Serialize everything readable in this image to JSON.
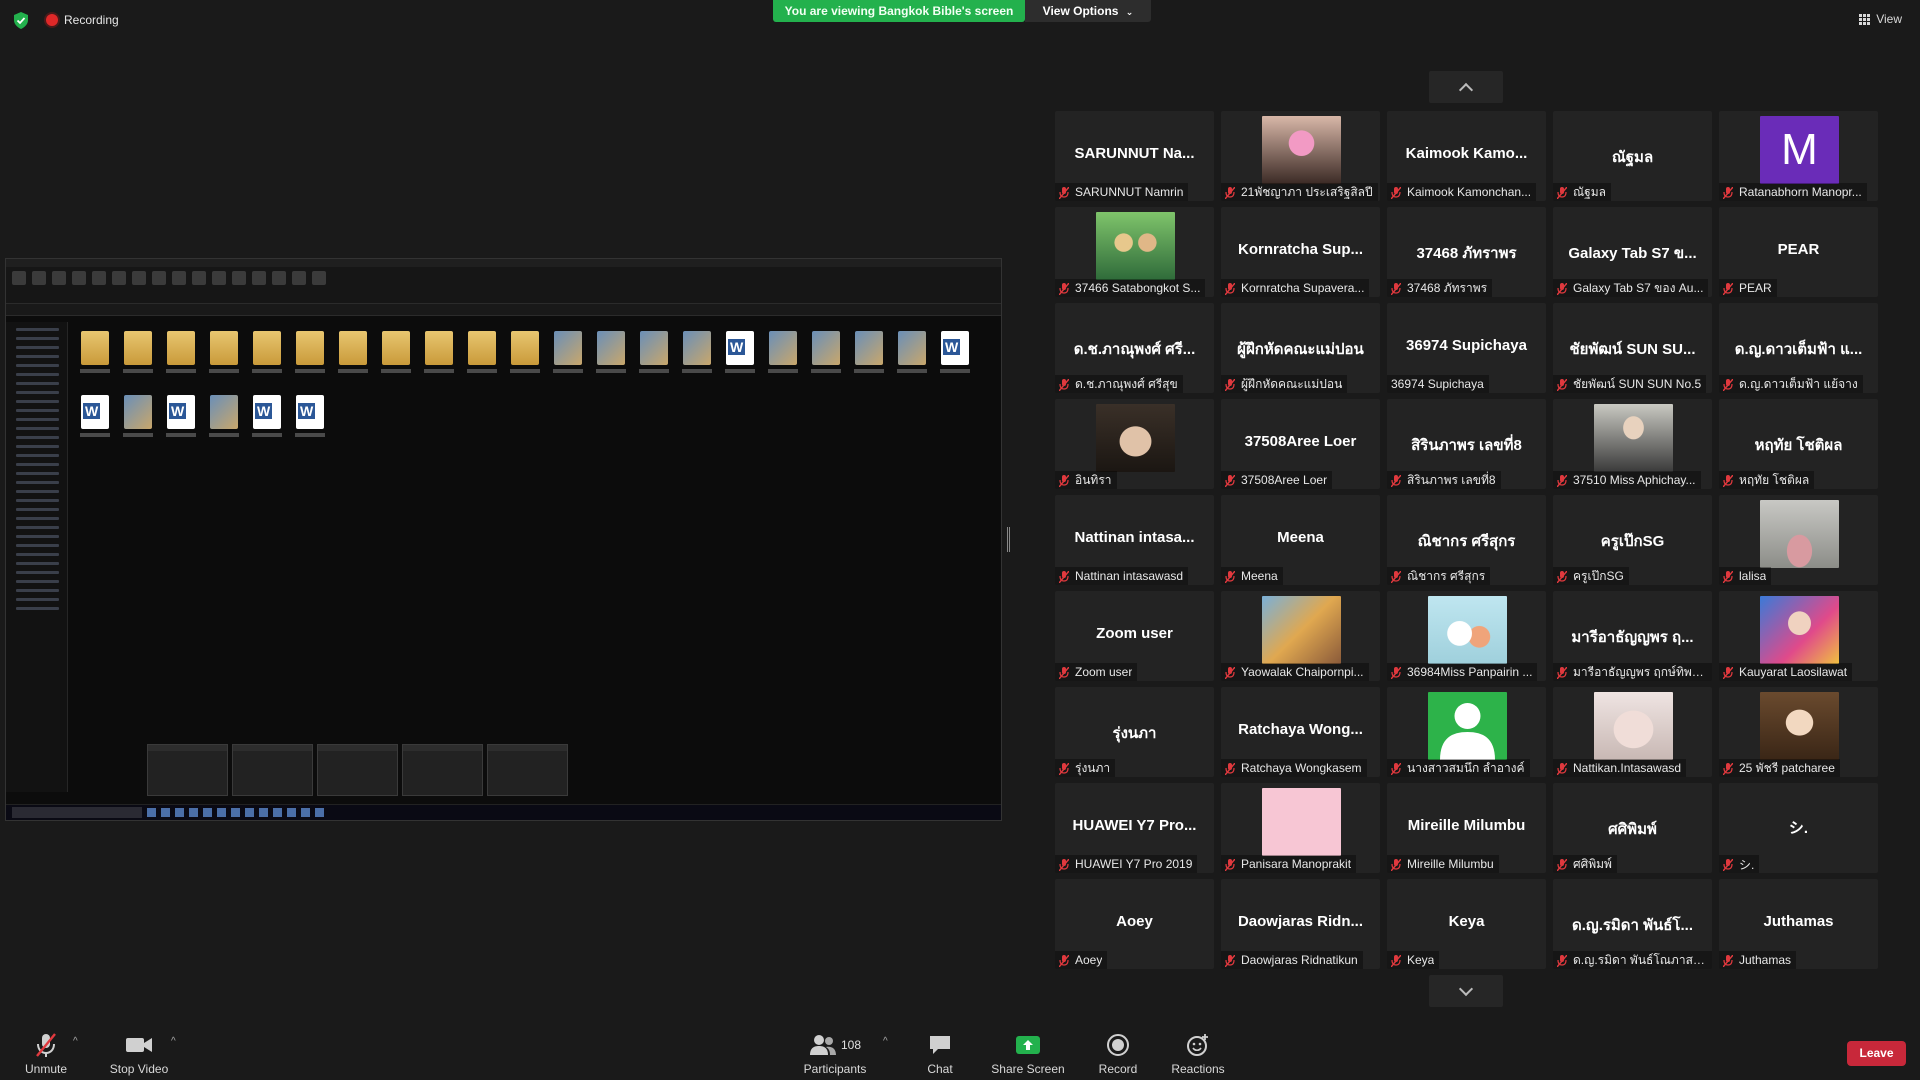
{
  "top": {
    "recording_label": "Recording",
    "viewing_banner": "You are viewing Bangkok Bible's screen",
    "view_options": "View Options",
    "view_label": "View"
  },
  "participants": [
    {
      "display": "SARUNNUT Na...",
      "label": "SARUNNUT Namrin",
      "pic": ""
    },
    {
      "display": "",
      "label": "21พัชญาภา ประเสริฐสิลปี",
      "pic": "photo-pink-glasses"
    },
    {
      "display": "Kaimook Kamo...",
      "label": "Kaimook Kamonchan...",
      "pic": ""
    },
    {
      "display": "ณัฐมล",
      "label": "ณัฐมล",
      "pic": ""
    },
    {
      "display": "",
      "label": "Ratanabhorn Manopr...",
      "pic": "avatar-m",
      "avatar_letter": "M"
    },
    {
      "display": "",
      "label": "37466 Satabongkot S...",
      "pic": "photo-garden"
    },
    {
      "display": "Kornratcha Sup...",
      "label": "Kornratcha Supavera...",
      "pic": ""
    },
    {
      "display": "37468 ภัทราพร",
      "label": "37468 ภัทราพร",
      "pic": ""
    },
    {
      "display": "Galaxy Tab S7 ข...",
      "label": "Galaxy Tab S7 ของ Au...",
      "pic": ""
    },
    {
      "display": "PEAR",
      "label": "PEAR",
      "pic": ""
    },
    {
      "display": "ด.ช.ภาณุพงศ์ ศรี...",
      "label": "ด.ช.ภาณุพงศ์ ศรีสุข",
      "pic": ""
    },
    {
      "display": "ผู้ฝึกหัดคณะแม่ปอน",
      "label": "ผู้ฝึกหัดคณะแม่ปอน",
      "pic": ""
    },
    {
      "display": "36974 Supichaya",
      "label": "36974 Supichaya",
      "pic": "",
      "muted": false
    },
    {
      "display": "ชัยพัฒน์ SUN SU...",
      "label": "ชัยพัฒน์ SUN SUN No.5",
      "pic": ""
    },
    {
      "display": "ด.ญ.ดาวเต็มฟ้า แ...",
      "label": "ด.ญ.ดาวเต็มฟ้า แย้จาง",
      "pic": ""
    },
    {
      "display": "",
      "label": "อินทิรา",
      "pic": "photo-anime-boy"
    },
    {
      "display": "37508Aree Loer",
      "label": "37508Aree Loer",
      "pic": ""
    },
    {
      "display": "สิรินภาพร เลขที่8",
      "label": "สิรินภาพร เลขที่8",
      "pic": ""
    },
    {
      "display": "",
      "label": "37510 Miss Aphichay...",
      "pic": "photo-man-suit"
    },
    {
      "display": "หฤทัย โชติผล",
      "label": "หฤทัย โชติผล",
      "pic": ""
    },
    {
      "display": "Nattinan intasa...",
      "label": "Nattinan intasawasd",
      "pic": ""
    },
    {
      "display": "Meena",
      "label": "Meena",
      "pic": ""
    },
    {
      "display": "ณิชากร ศรีสุกร",
      "label": "ณิชากร ศรีสุกร",
      "pic": ""
    },
    {
      "display": "ครูเป๊กSG",
      "label": "ครูเป๊กSG",
      "pic": ""
    },
    {
      "display": "",
      "label": "lalisa",
      "pic": "photo-lalisa"
    },
    {
      "display": "Zoom user",
      "label": "Zoom user",
      "pic": ""
    },
    {
      "display": "",
      "label": "Yaowalak Chaipornpi...",
      "pic": "photo-cartoon-crowd"
    },
    {
      "display": "",
      "label": "36984Miss Panpairin ...",
      "pic": "photo-cartoon-friends"
    },
    {
      "display": "มารีอาธัญญพร ฤ...",
      "label": "มารีอาธัญญพร ฤกษ์ทิพย์...",
      "pic": ""
    },
    {
      "display": "",
      "label": "Kauyarat Laosilawat",
      "pic": "photo-colorful-boy"
    },
    {
      "display": "รุ่งนภา",
      "label": "รุ่งนภา",
      "pic": ""
    },
    {
      "display": "Ratchaya Wong...",
      "label": "Ratchaya Wongkasem",
      "pic": ""
    },
    {
      "display": "",
      "label": "นางสาวสมนึก ลำอางค์",
      "pic": "avatar-generic"
    },
    {
      "display": "",
      "label": "Nattikan.Intasawasd",
      "pic": "photo-hand-face"
    },
    {
      "display": "",
      "label": "25 พัชรี patcharee",
      "pic": "photo-anime-girl"
    },
    {
      "display": "HUAWEI Y7 Pro...",
      "label": "HUAWEI Y7 Pro 2019",
      "pic": ""
    },
    {
      "display": "",
      "label": "Panisara Manoprakit",
      "pic": "photo-pink-square"
    },
    {
      "display": "Mireille Milumbu",
      "label": "Mireille Milumbu",
      "pic": ""
    },
    {
      "display": "ศศิพิมพ์",
      "label": "ศศิพิมพ์",
      "pic": ""
    },
    {
      "display": "シ.",
      "label": "シ.",
      "pic": ""
    },
    {
      "display": "Aoey",
      "label": "Aoey",
      "pic": ""
    },
    {
      "display": "Daowjaras Ridn...",
      "label": "Daowjaras Ridnatikun",
      "pic": ""
    },
    {
      "display": "Keya",
      "label": "Keya",
      "pic": ""
    },
    {
      "display": "ด.ญ.รมิดา พันธ์โ...",
      "label": "ด.ญ.รมิดา พันธ์โณภาส แ...",
      "pic": ""
    },
    {
      "display": "Juthamas",
      "label": "Juthamas",
      "pic": ""
    }
  ],
  "toolbar": {
    "unmute": "Unmute",
    "stop_video": "Stop Video",
    "participants": "Participants",
    "participants_count": "108",
    "chat": "Chat",
    "share_screen": "Share Screen",
    "record": "Record",
    "reactions": "Reactions",
    "leave": "Leave"
  },
  "colors": {
    "background": "#1a1a1a",
    "tile": "#232323",
    "banner_green": "#23b14d",
    "leave_red": "#c8283a",
    "muted_red": "#e0393e"
  }
}
